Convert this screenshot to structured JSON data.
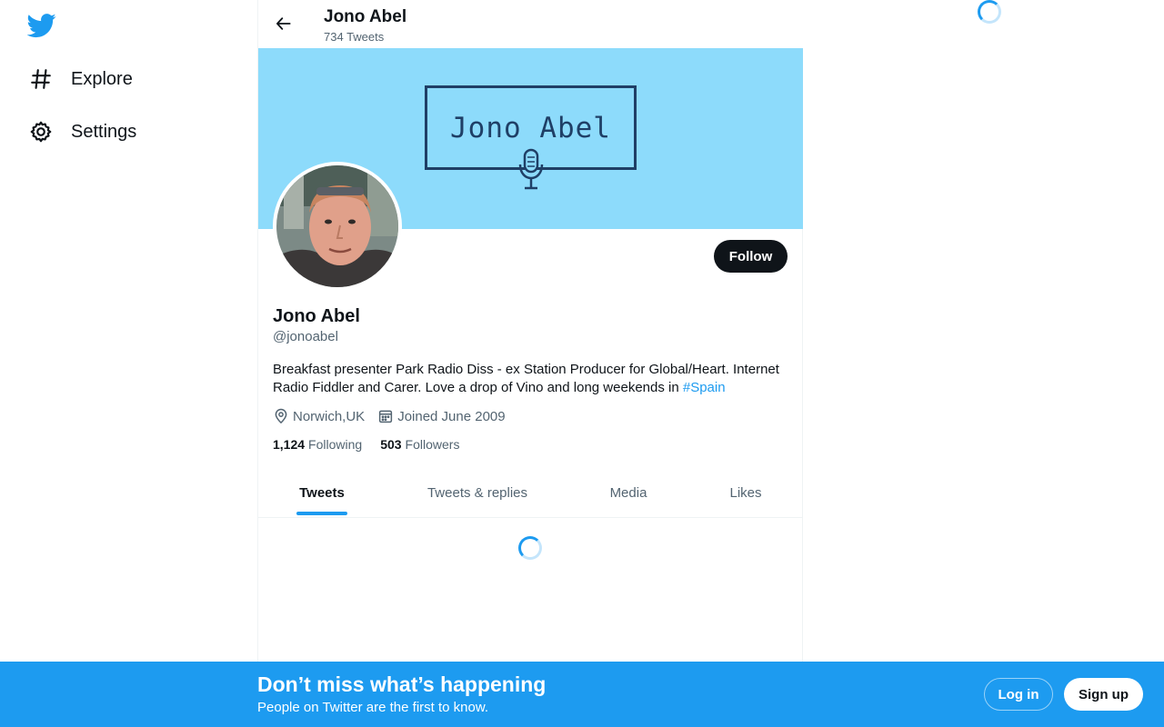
{
  "colors": {
    "accent": "#1d9bf0",
    "banner_bg": "#8ddbfb",
    "text": "#0f1419",
    "muted": "#536471"
  },
  "sidebar": {
    "logo_icon": "twitter-bird-icon",
    "items": [
      {
        "label": "Explore",
        "icon": "hashtag-icon"
      },
      {
        "label": "Settings",
        "icon": "gear-icon"
      }
    ]
  },
  "header": {
    "name": "Jono Abel",
    "tweet_count": "734 Tweets",
    "back_icon": "back-arrow-icon"
  },
  "banner": {
    "text": "Jono Abel",
    "icon": "microphone-icon"
  },
  "profile": {
    "follow_label": "Follow",
    "name": "Jono Abel",
    "handle": "@jonoabel",
    "bio_text": "Breakfast presenter Park Radio Diss - ex Station Producer for Global/Heart. Internet Radio Fiddler and Carer. Love a drop of Vino and long weekends in ",
    "bio_hashtag": "#Spain",
    "location": "Norwich,UK",
    "joined": "Joined June 2009",
    "following_count": "1,124",
    "following_label": "Following",
    "followers_count": "503",
    "followers_label": "Followers"
  },
  "tabs": [
    {
      "label": "Tweets",
      "active": true
    },
    {
      "label": "Tweets & replies",
      "active": false
    },
    {
      "label": "Media",
      "active": false
    },
    {
      "label": "Likes",
      "active": false
    }
  ],
  "bottom_bar": {
    "title": "Don’t miss what’s happening",
    "subtitle": "People on Twitter are the first to know.",
    "login_label": "Log in",
    "signup_label": "Sign up"
  }
}
